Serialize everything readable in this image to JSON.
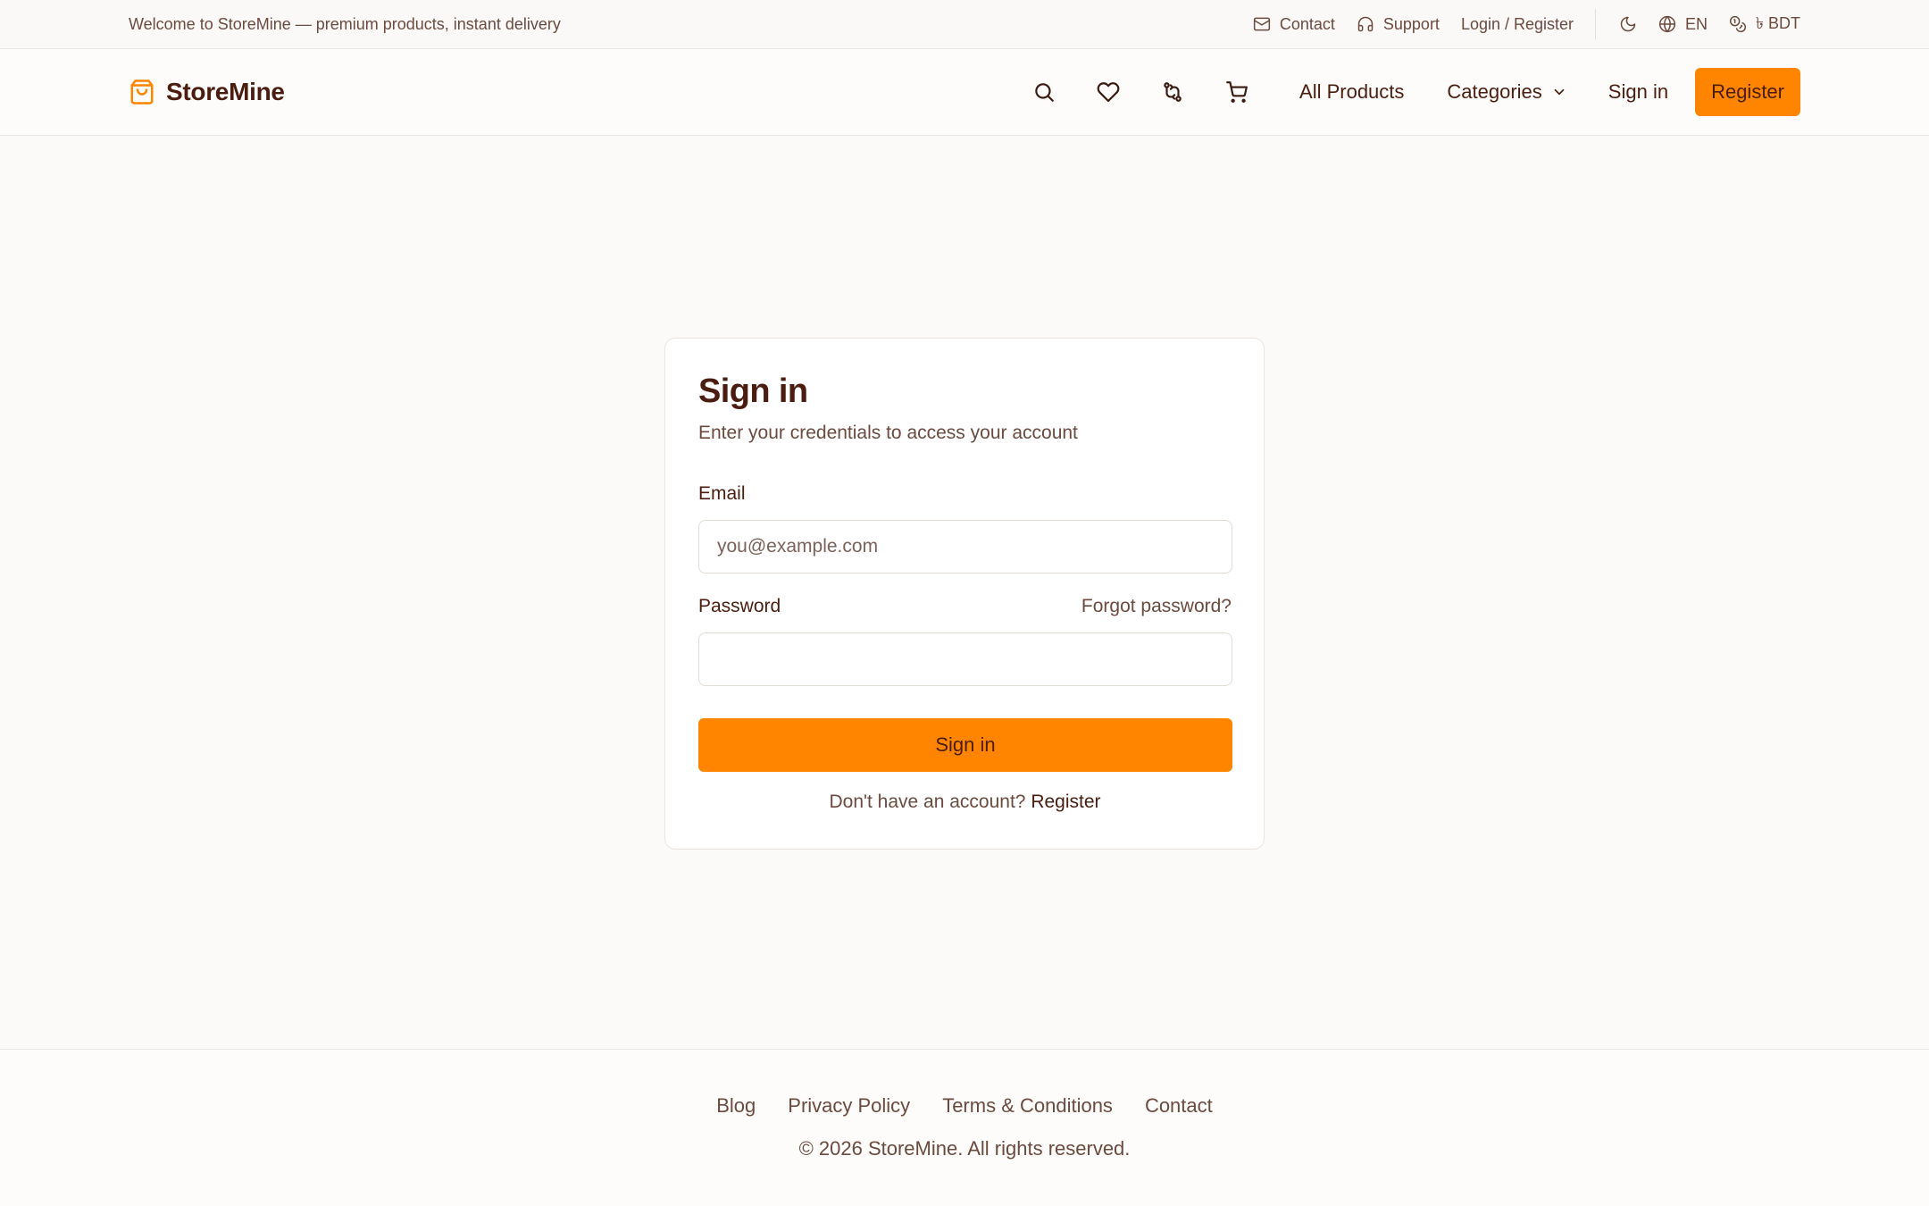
{
  "topbar": {
    "welcome": "Welcome to StoreMine — premium products, instant delivery",
    "contact": "Contact",
    "support": "Support",
    "login_register": "Login / Register",
    "language": "EN",
    "currency": "৳ BDT",
    "icons": [
      "mail-icon",
      "headset-icon",
      "moon-icon",
      "globe-icon",
      "coins-icon"
    ]
  },
  "header": {
    "brand": "StoreMine",
    "icons": [
      "search-icon",
      "heart-icon",
      "compare-icon",
      "cart-icon"
    ],
    "nav": {
      "all_products": "All Products",
      "categories": "Categories",
      "sign_in": "Sign in",
      "register": "Register"
    }
  },
  "signin": {
    "title": "Sign in",
    "subtitle": "Enter your credentials to access your account",
    "email_label": "Email",
    "email_placeholder": "you@example.com",
    "email_value": "",
    "password_label": "Password",
    "forgot": "Forgot password?",
    "password_value": "",
    "submit": "Sign in",
    "no_account": "Don't have an account?",
    "register_link": "Register"
  },
  "footer": {
    "links": [
      "Blog",
      "Privacy Policy",
      "Terms & Conditions",
      "Contact"
    ],
    "copyright": "© 2026 StoreMine. All rights reserved."
  },
  "colors": {
    "accent": "#ff8500",
    "text_primary": "#4a1d10",
    "text_secondary": "#6b4a3f",
    "background": "#fbfaf8"
  }
}
